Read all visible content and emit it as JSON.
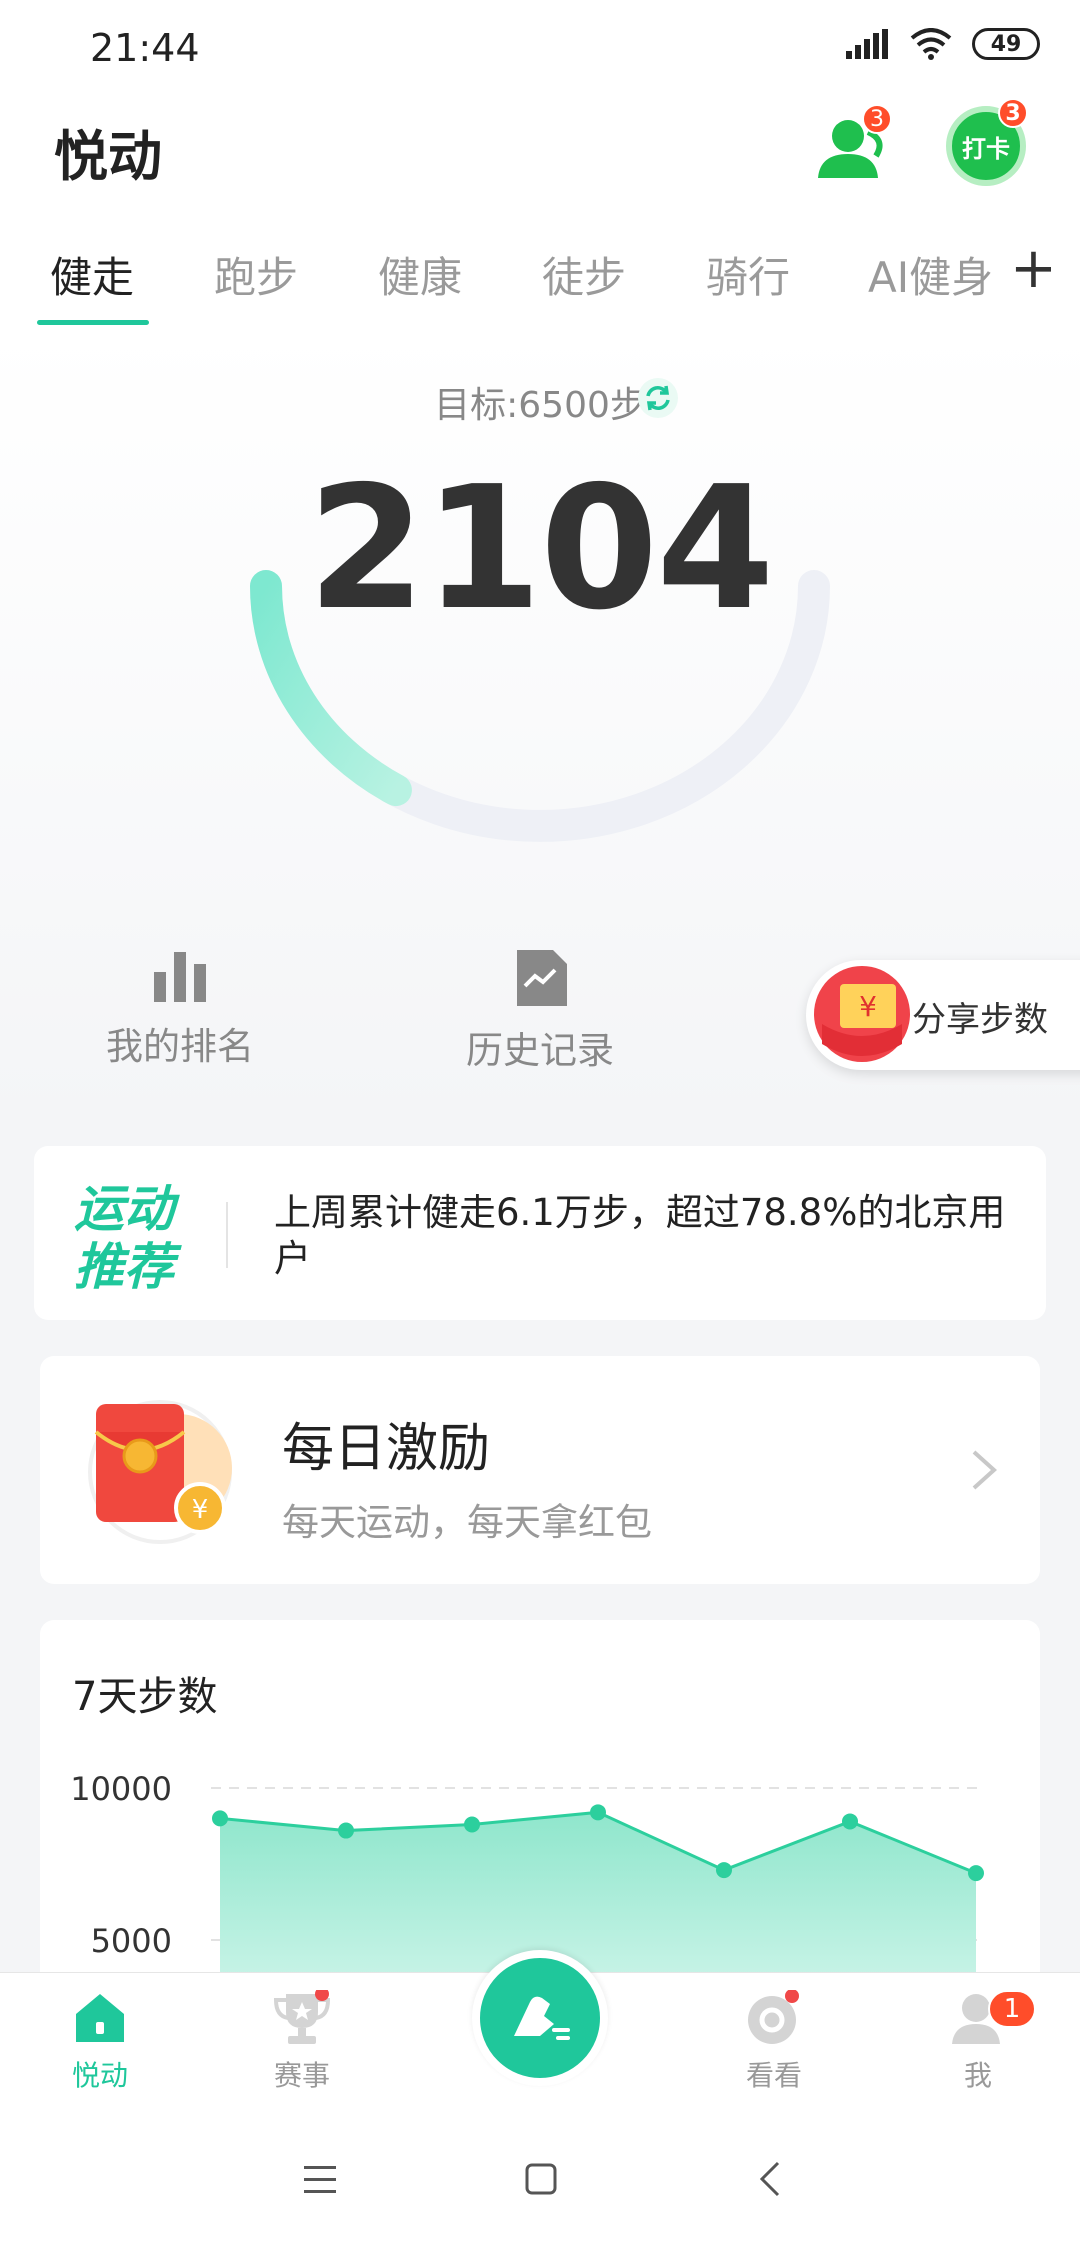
{
  "status_bar": {
    "time": "21:44",
    "battery": "49"
  },
  "header": {
    "title": "悦动",
    "friends_badge": "3",
    "punch_label": "打卡",
    "punch_badge": "3"
  },
  "tabs": [
    {
      "label": "健走",
      "active": true
    },
    {
      "label": "跑步"
    },
    {
      "label": "健康"
    },
    {
      "label": "徒步"
    },
    {
      "label": "骑行"
    },
    {
      "label": "AI健身"
    }
  ],
  "tab_add": "+",
  "hero": {
    "goal": "目标:6500步",
    "steps": "2104",
    "progress": 0.3237
  },
  "quick_actions": {
    "ranking": "我的排名",
    "history": "历史记录",
    "share": "分享步数"
  },
  "recommend": {
    "title": "运动推荐",
    "text": "上周累计健走6.1万步，超过78.8%的北京用户"
  },
  "reward": {
    "title": "每日激励",
    "subtitle": "每天运动，每天拿红包"
  },
  "chart": {
    "title": "7天步数"
  },
  "chart_data": {
    "type": "area",
    "title": "7天步数",
    "x": [
      1,
      2,
      3,
      4,
      5,
      6,
      7
    ],
    "values": [
      9000,
      8600,
      8800,
      9200,
      7300,
      8900,
      7200
    ],
    "yticks": [
      "10000",
      "5000"
    ],
    "ylim": [
      0,
      10000
    ],
    "grid": true,
    "color": "#2ccf9d"
  },
  "bottom_nav": [
    {
      "label": "悦动",
      "icon": "home-icon",
      "active": true
    },
    {
      "label": "赛事",
      "icon": "trophy-icon",
      "dot": true
    },
    {
      "label": "",
      "icon": "walk-icon"
    },
    {
      "label": "看看",
      "icon": "explore-icon",
      "dot": true
    },
    {
      "label": "我",
      "icon": "profile-icon",
      "badge": "1"
    }
  ],
  "colors": {
    "accent": "#1fc79b",
    "badge": "#ff4d2a",
    "punch": "#1fbf4e"
  }
}
